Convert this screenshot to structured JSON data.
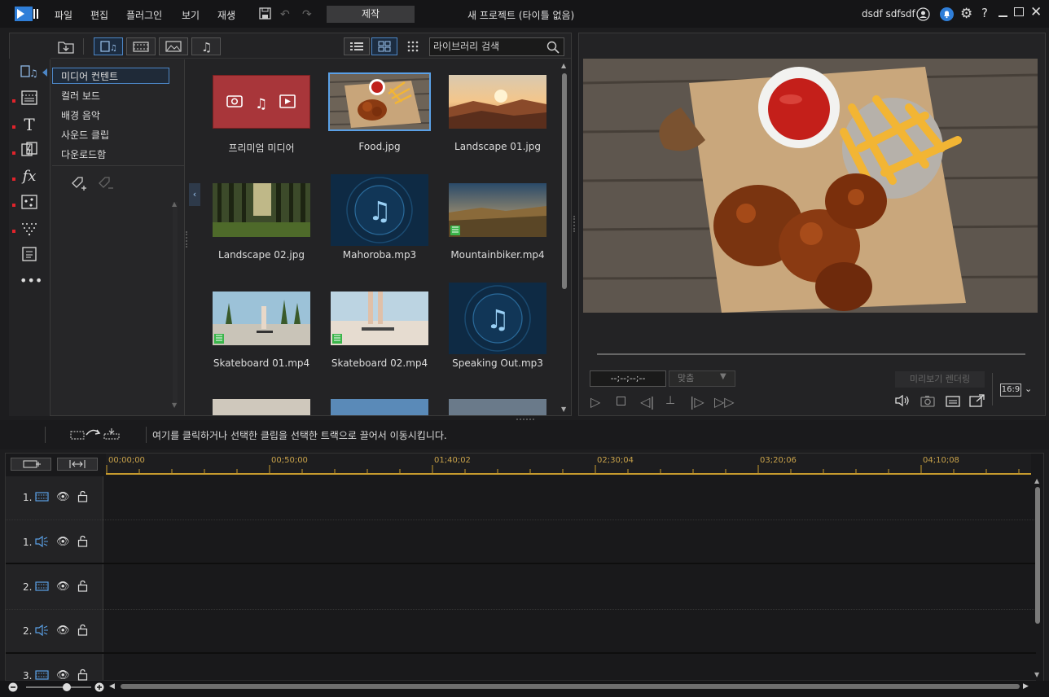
{
  "menu": {
    "items": [
      "파일",
      "편집",
      "플러그인",
      "보기",
      "재생"
    ],
    "mode_tab": "제작"
  },
  "project_title": "새 프로젝트 (타이틀 없음)",
  "user": {
    "name": "dsdf sdfsdf"
  },
  "library": {
    "search_placeholder": "라이브러리 검색",
    "categories": [
      "미디어 컨텐트",
      "컬러 보드",
      "배경 음악",
      "사운드 클립",
      "다운로드함"
    ],
    "selected_category": "미디어 컨텐트",
    "items": [
      {
        "label": "프리미엄 미디어",
        "kind": "premium"
      },
      {
        "label": "Food.jpg",
        "kind": "photo",
        "selected": true
      },
      {
        "label": "Landscape 01.jpg",
        "kind": "photo"
      },
      {
        "label": "Landscape 02.jpg",
        "kind": "photo"
      },
      {
        "label": "Mahoroba.mp3",
        "kind": "audio"
      },
      {
        "label": "Mountainbiker.mp4",
        "kind": "video"
      },
      {
        "label": "Skateboard 01.mp4",
        "kind": "video"
      },
      {
        "label": "Skateboard 02.mp4",
        "kind": "video"
      },
      {
        "label": "Speaking Out.mp3",
        "kind": "audio"
      }
    ]
  },
  "preview": {
    "timecode": "--;--;--;--",
    "fit_label": "맞춤",
    "render_button": "미리보기 렌더링",
    "aspect_ratio": "16:9"
  },
  "timeline": {
    "instruction": "여기를 클릭하거나 선택한 클립을 선택한 트랙으로 끌어서 이동시킵니다.",
    "ruler_labels": [
      "00;00;00",
      "00;50;00",
      "01;40;02",
      "02;30;04",
      "03;20;06",
      "04;10;08"
    ],
    "tracks": [
      {
        "name": "1.",
        "type": "video"
      },
      {
        "name": "1.",
        "type": "audio"
      },
      {
        "name": "2.",
        "type": "video"
      },
      {
        "name": "2.",
        "type": "audio"
      },
      {
        "name": "3.",
        "type": "video"
      }
    ]
  },
  "colors": {
    "accent": "#4c86c6",
    "ruler": "#c69a2e",
    "premium": "#a8363a"
  }
}
